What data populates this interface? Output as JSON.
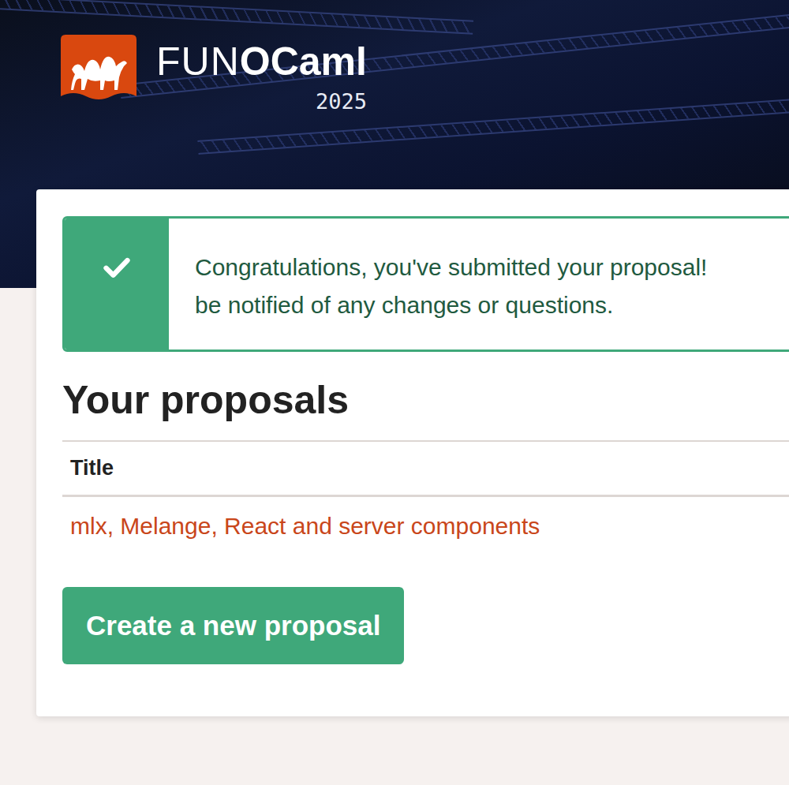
{
  "brand": {
    "prefix": "FUN",
    "name": "OCaml",
    "year": "2025"
  },
  "alert": {
    "lines": [
      "Congratulations, you've submitted your proposal!",
      "be notified of any changes or questions."
    ]
  },
  "heading": "Your proposals",
  "table": {
    "columns": [
      "Title"
    ],
    "rows": [
      {
        "title": "mlx, Melange, React and server components"
      }
    ]
  },
  "button": "Create a new proposal"
}
